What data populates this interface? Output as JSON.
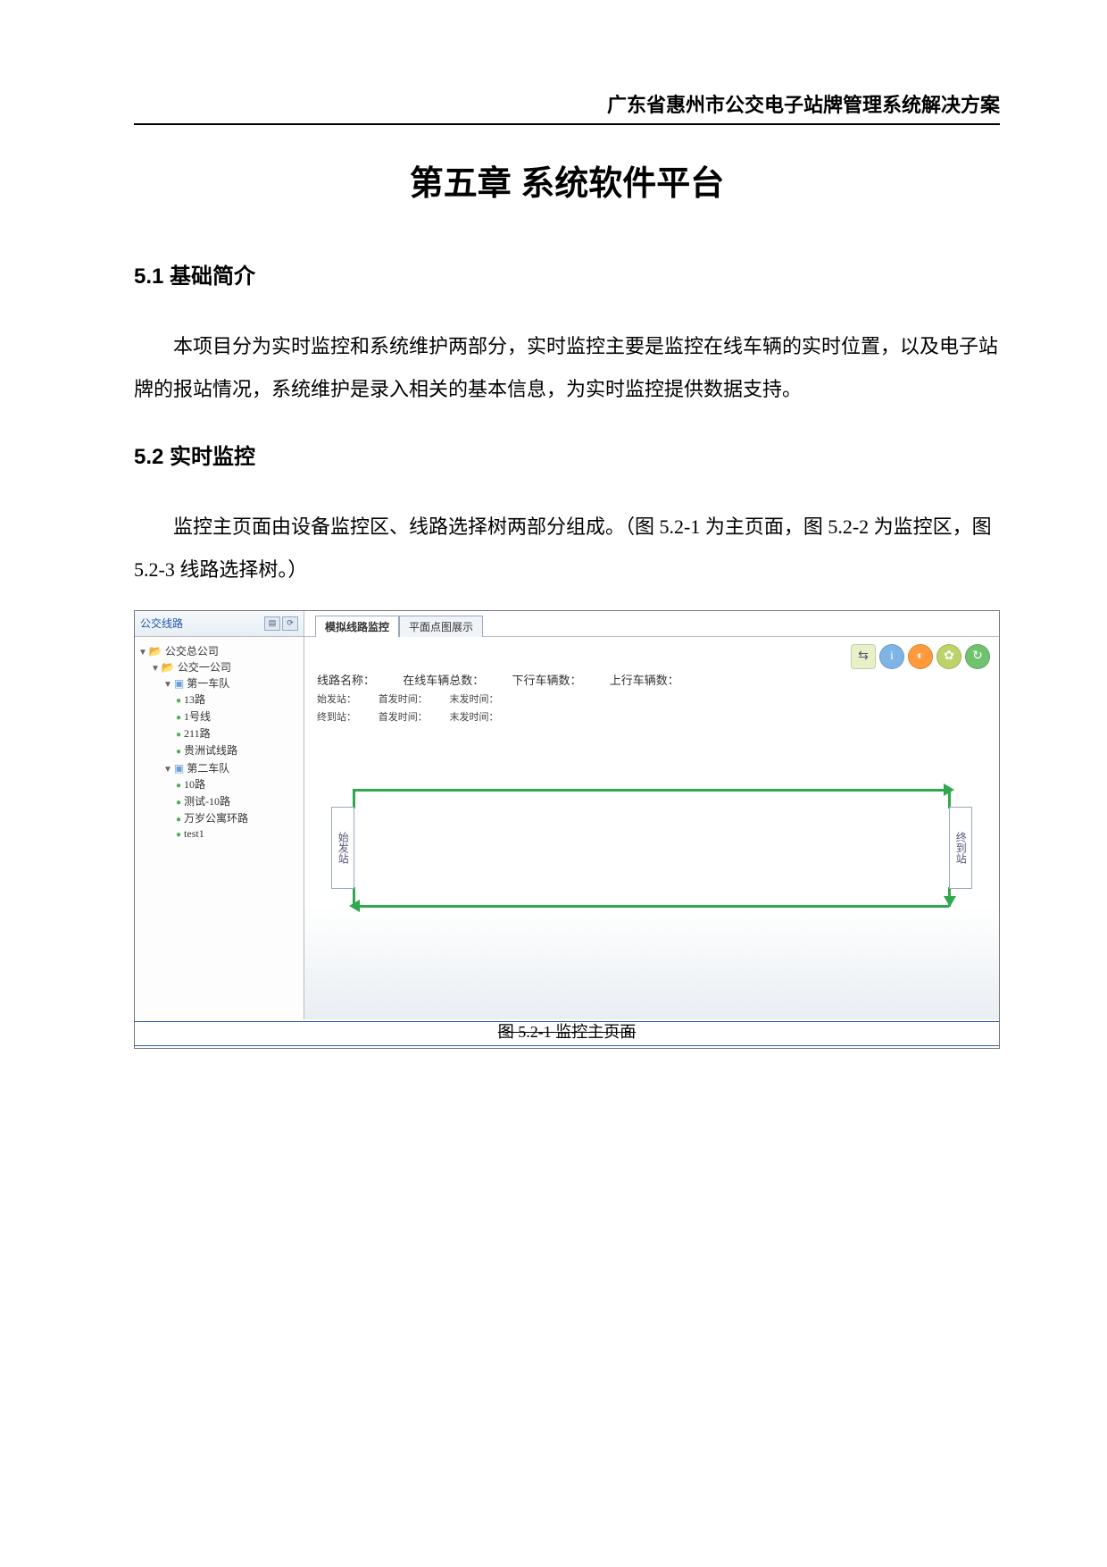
{
  "header": {
    "title": "广东省惠州市公交电子站牌管理系统解决方案"
  },
  "chapter": {
    "title": "第五章 系统软件平台"
  },
  "sections": {
    "s1": {
      "heading": "5.1 基础简介",
      "para": "本项目分为实时监控和系统维护两部分，实时监控主要是监控在线车辆的实时位置，以及电子站牌的报站情况，系统维护是录入相关的基本信息，为实时监控提供数据支持。"
    },
    "s2": {
      "heading": "5.2 实时监控",
      "para": "监控主页面由设备监控区、线路选择树两部分组成。（图 5.2-1 为主页面，图 5.2-2 为监控区，图 5.2-3 线路选择树。）"
    }
  },
  "screenshot": {
    "tree_title": "公交线路",
    "tabs": {
      "t1": "模拟线路监控",
      "t2": "平面点图展示"
    },
    "tree": {
      "root": "公交总公司",
      "company1": "公交一公司",
      "team1": "第一车队",
      "line_13": "13路",
      "line_1": "1号线",
      "line_211": "211路",
      "line_gz": "贵洲试线路",
      "team2": "第二车队",
      "line_10": "10路",
      "line_test10": "测试-10路",
      "line_wansui": "万岁公寓环路",
      "line_test1": "test1"
    },
    "info": {
      "route_name_label": "线路名称：",
      "online_total_label": "在线车辆总数：",
      "down_count_label": "下行车辆数：",
      "up_count_label": "上行车辆数：",
      "start_station_label": "始发站：",
      "first_time_label": "首发时间：",
      "last_time_label": "末发时间：",
      "end_station_label": "终到站：",
      "first_time_label2": "首发时间：",
      "last_time_label2": "末发时间："
    },
    "station_left": "始发站",
    "station_right": "终到站",
    "caption": "图 5.2-1 监控主页面"
  }
}
